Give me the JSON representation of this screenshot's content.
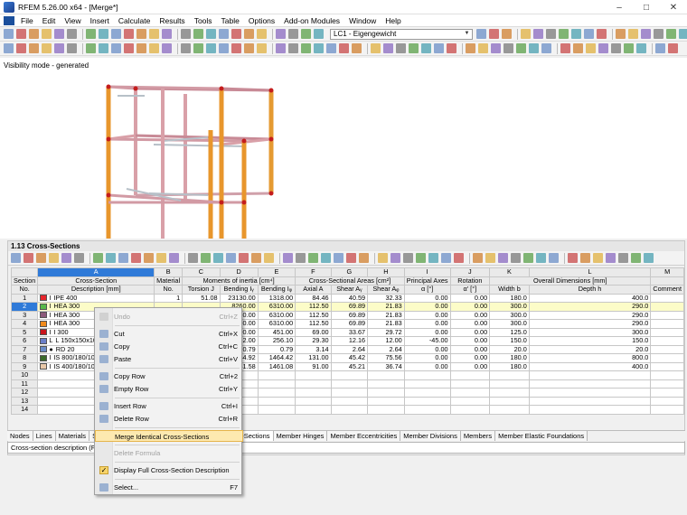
{
  "window": {
    "title": "RFEM 5.26.00 x64 - [Merge*]"
  },
  "menu": [
    "File",
    "Edit",
    "View",
    "Insert",
    "Calculate",
    "Results",
    "Tools",
    "Table",
    "Options",
    "Add-on Modules",
    "Window",
    "Help"
  ],
  "toolbar": {
    "load_case": "LC1 - Eigengewicht"
  },
  "view": {
    "visibility_label": "Visibility mode - generated"
  },
  "panel": {
    "title": "1.13 Cross-Sections"
  },
  "table": {
    "col_letters": [
      "A",
      "B",
      "C",
      "D",
      "E",
      "F",
      "G",
      "H",
      "I",
      "J",
      "K",
      "L",
      "M"
    ],
    "group_headers": {
      "section": "Section",
      "cross_section": "Cross-Section",
      "material": "Material",
      "moments": "Moments of inertia [cm⁴]",
      "areas": "Cross-Sectional Areas [cm²]",
      "principal": "Principal Axes",
      "rotation": "Rotation",
      "dims": "Overall Dimensions [mm]",
      "comment": "Comment"
    },
    "sub_headers": {
      "no": "No.",
      "desc": "Description [mm]",
      "mat_no": "No.",
      "torsion": "Torsion J",
      "bend_y": "Bending Iᵧ",
      "bend_z": "Bending Iᵩ",
      "axial": "Axial A",
      "shear_y": "Shear Aᵧ",
      "shear_z": "Shear Aᵩ",
      "alpha": "α [°]",
      "alpha_p": "α' [°]",
      "width": "Width b",
      "depth": "Depth h"
    },
    "rows": [
      {
        "no": "1",
        "sym": "I",
        "desc": "IPE 400",
        "color": "#e8262c",
        "mat": "1",
        "J": "51.08",
        "Iy": "23130.00",
        "Iz": "1318.00",
        "A": "84.46",
        "Ay": "40.59",
        "Az": "32.33",
        "alpha": "0.00",
        "alphap": "0.00",
        "b": "180.0",
        "h": "400.0"
      },
      {
        "no": "2",
        "sym": "I",
        "desc": "HEA 300",
        "color": "#58b848",
        "mat": "",
        "J": "",
        "Iy": "8260.00",
        "Iz": "6310.00",
        "A": "112.50",
        "Ay": "69.89",
        "Az": "21.83",
        "alpha": "0.00",
        "alphap": "0.00",
        "b": "300.0",
        "h": "290.0"
      },
      {
        "no": "3",
        "sym": "I",
        "desc": "HEA 300",
        "color": "#8c5a7a",
        "mat": "",
        "J": "",
        "Iy": "8260.00",
        "Iz": "6310.00",
        "A": "112.50",
        "Ay": "69.89",
        "Az": "21.83",
        "alpha": "0.00",
        "alphap": "0.00",
        "b": "300.0",
        "h": "290.0"
      },
      {
        "no": "4",
        "sym": "I",
        "desc": "HEA 300",
        "color": "#f08a1c",
        "mat": "",
        "J": "",
        "Iy": "8260.00",
        "Iz": "6310.00",
        "A": "112.50",
        "Ay": "69.89",
        "Az": "21.83",
        "alpha": "0.00",
        "alphap": "0.00",
        "b": "300.0",
        "h": "290.0"
      },
      {
        "no": "5",
        "sym": "I",
        "desc": "I 300",
        "color": "#c8141c",
        "mat": "",
        "J": "",
        "Iy": "9800.00",
        "Iz": "451.00",
        "A": "69.00",
        "Ay": "33.67",
        "Az": "29.72",
        "alpha": "0.00",
        "alphap": "0.00",
        "b": "125.0",
        "h": "300.0"
      },
      {
        "no": "6",
        "sym": "L",
        "desc": "L 150x150x10",
        "color": "#6a7ec8",
        "mat": "",
        "J": "",
        "Iy": "992.00",
        "Iz": "256.10",
        "A": "29.30",
        "Ay": "12.16",
        "Az": "12.00",
        "alpha": "-45.00",
        "alphap": "0.00",
        "b": "150.0",
        "h": "150.0"
      },
      {
        "no": "7",
        "sym": "●",
        "desc": "RD 20",
        "color": "#6a8cc8",
        "mat": "",
        "J": "",
        "Iy": "0.79",
        "Iz": "0.79",
        "A": "3.14",
        "Ay": "2.64",
        "Az": "2.64",
        "alpha": "0.00",
        "alphap": "0.00",
        "b": "20.0",
        "h": "20.0"
      },
      {
        "no": "8",
        "sym": "I",
        "desc": "IS 800/180/10",
        "color": "#3a6a2a",
        "mat": "",
        "J": "",
        "Iy": "21244.92",
        "Iz": "1464.42",
        "A": "131.00",
        "Ay": "45.42",
        "Az": "75.56",
        "alpha": "0.00",
        "alphap": "0.00",
        "b": "180.0",
        "h": "800.0"
      },
      {
        "no": "9",
        "sym": "I",
        "desc": "IS 400/180/10",
        "color": "#e8c8a8",
        "mat": "",
        "J": "",
        "Iy": "24241.58",
        "Iz": "1461.08",
        "A": "91.00",
        "Ay": "45.21",
        "Az": "36.74",
        "alpha": "0.00",
        "alphap": "0.00",
        "b": "180.0",
        "h": "400.0"
      }
    ],
    "empty_rows": [
      "10",
      "11",
      "12",
      "13",
      "14"
    ]
  },
  "tabs": [
    "Nodes",
    "Lines",
    "Materials",
    "Sur",
    "rts",
    "Surface Supports",
    "Line Hinges",
    "Cross-Sections",
    "Member Hinges",
    "Member Eccentricities",
    "Member Divisions",
    "Members",
    "Member Elastic Foundations"
  ],
  "status": "Cross-section description (F",
  "context_menu": [
    {
      "label": "Undo",
      "shortcut": "Ctrl+Z",
      "disabled": true,
      "icon": "undo-icon"
    },
    {
      "sep": true
    },
    {
      "label": "Cut",
      "shortcut": "Ctrl+X",
      "icon": "cut-icon"
    },
    {
      "label": "Copy",
      "shortcut": "Ctrl+C",
      "icon": "copy-icon"
    },
    {
      "label": "Paste",
      "shortcut": "Ctrl+V",
      "icon": "paste-icon"
    },
    {
      "sep": true
    },
    {
      "label": "Copy Row",
      "shortcut": "Ctrl+2",
      "icon": "copy-row-icon"
    },
    {
      "label": "Empty Row",
      "shortcut": "Ctrl+Y",
      "icon": "empty-row-icon"
    },
    {
      "sep": true
    },
    {
      "label": "Insert Row",
      "shortcut": "Ctrl+I",
      "icon": "insert-row-icon"
    },
    {
      "label": "Delete Row",
      "shortcut": "Ctrl+R",
      "icon": "delete-row-icon"
    },
    {
      "sep": true
    },
    {
      "label": "Merge Identical Cross-Sections",
      "shortcut": "",
      "highlighted": true
    },
    {
      "sep": true
    },
    {
      "label": "Delete Formula",
      "shortcut": "",
      "disabled": true
    },
    {
      "sep": true
    },
    {
      "label": "Display Full Cross-Section Description",
      "shortcut": "",
      "checked": true,
      "icon": "check-icon"
    },
    {
      "sep": true
    },
    {
      "label": "Select...",
      "shortcut": "F7",
      "icon": "select-icon"
    }
  ]
}
